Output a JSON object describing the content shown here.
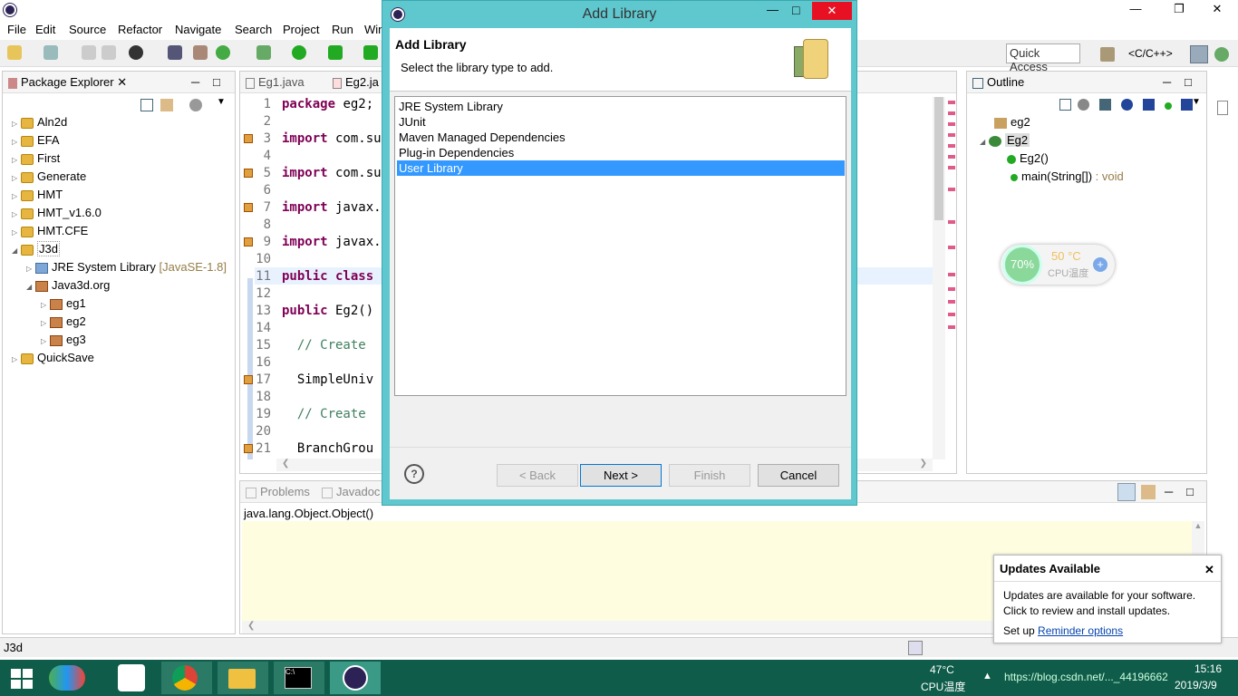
{
  "menu": [
    "File",
    "Edit",
    "Source",
    "Refactor",
    "Navigate",
    "Search",
    "Project",
    "Run",
    "Win"
  ],
  "toolbar": {
    "quick_access": "Quick Access",
    "perspective": "<C/C++>"
  },
  "package_explorer": {
    "tab": "Package Explorer",
    "items": [
      {
        "label": "Aln2d"
      },
      {
        "label": "EFA"
      },
      {
        "label": "First"
      },
      {
        "label": "Generate"
      },
      {
        "label": "HMT"
      },
      {
        "label": "HMT_v1.6.0"
      },
      {
        "label": "HMT.CFE"
      },
      {
        "label": "J3d"
      },
      {
        "label": "JRE System Library",
        "decor": "[JavaSE-1.8]"
      },
      {
        "label": "Java3d.org"
      },
      {
        "label": "eg1"
      },
      {
        "label": "eg2"
      },
      {
        "label": "eg3"
      },
      {
        "label": "QuickSave"
      }
    ]
  },
  "editor": {
    "tabs": [
      "Eg1.java",
      "Eg2.ja"
    ],
    "lines": [
      {
        "n": "1",
        "text": "package eg2;"
      },
      {
        "n": "2",
        "text": ""
      },
      {
        "n": "3",
        "text": "import com.su"
      },
      {
        "n": "4",
        "text": ""
      },
      {
        "n": "5",
        "text": "import com.su"
      },
      {
        "n": "6",
        "text": ""
      },
      {
        "n": "7",
        "text": "import javax."
      },
      {
        "n": "8",
        "text": ""
      },
      {
        "n": "9",
        "text": "import javax."
      },
      {
        "n": "10",
        "text": ""
      },
      {
        "n": "11",
        "text": "public class"
      },
      {
        "n": "12",
        "text": ""
      },
      {
        "n": "13",
        "text": "public Eg2()"
      },
      {
        "n": "14",
        "text": ""
      },
      {
        "n": "15",
        "text": "  // Create"
      },
      {
        "n": "16",
        "text": ""
      },
      {
        "n": "17",
        "text": "  SimpleUniv"
      },
      {
        "n": "18",
        "text": ""
      },
      {
        "n": "19",
        "text": "  // Create"
      },
      {
        "n": "20",
        "text": ""
      },
      {
        "n": "21",
        "text": "  BranchGrou"
      }
    ]
  },
  "outline": {
    "tab": "Outline",
    "items": [
      {
        "label": "eg2"
      },
      {
        "label": "Eg2"
      },
      {
        "label": "Eg2()"
      },
      {
        "label": "main(String[])",
        "suffix": ": void"
      }
    ]
  },
  "cpu_widget": {
    "percent": "70%",
    "temp": "50 °C",
    "label": "CPU温度"
  },
  "bottom": {
    "tabs": [
      "Problems",
      "Javadoc"
    ],
    "javadoc_text": "java.lang.Object.Object()"
  },
  "status": {
    "text": "J3d"
  },
  "dialog": {
    "window_title": "Add Library",
    "heading": "Add Library",
    "subtitle": "Select the library type to add.",
    "libraries": [
      "JRE System Library",
      "JUnit",
      "Maven Managed Dependencies",
      "Plug-in Dependencies",
      "User Library"
    ],
    "selected_index": 4,
    "buttons": {
      "back": "< Back",
      "next": "Next >",
      "finish": "Finish",
      "cancel": "Cancel"
    }
  },
  "notification": {
    "title": "Updates Available",
    "line1": "Updates are available for your software.",
    "line2": "Click to review and install updates.",
    "setup_prefix": "Set up",
    "link": "Reminder options"
  },
  "taskbar": {
    "temp": "47°C",
    "temp_label": "CPU温度",
    "time": "15:16",
    "date": "2019/3/9",
    "watermark": "https://blog.csdn.net/..._44196662"
  },
  "colors": {
    "accent": "#3399ff",
    "dialog_frame": "#5fc8cf",
    "taskbar": "#0f5c4a",
    "close_red": "#e81123"
  }
}
